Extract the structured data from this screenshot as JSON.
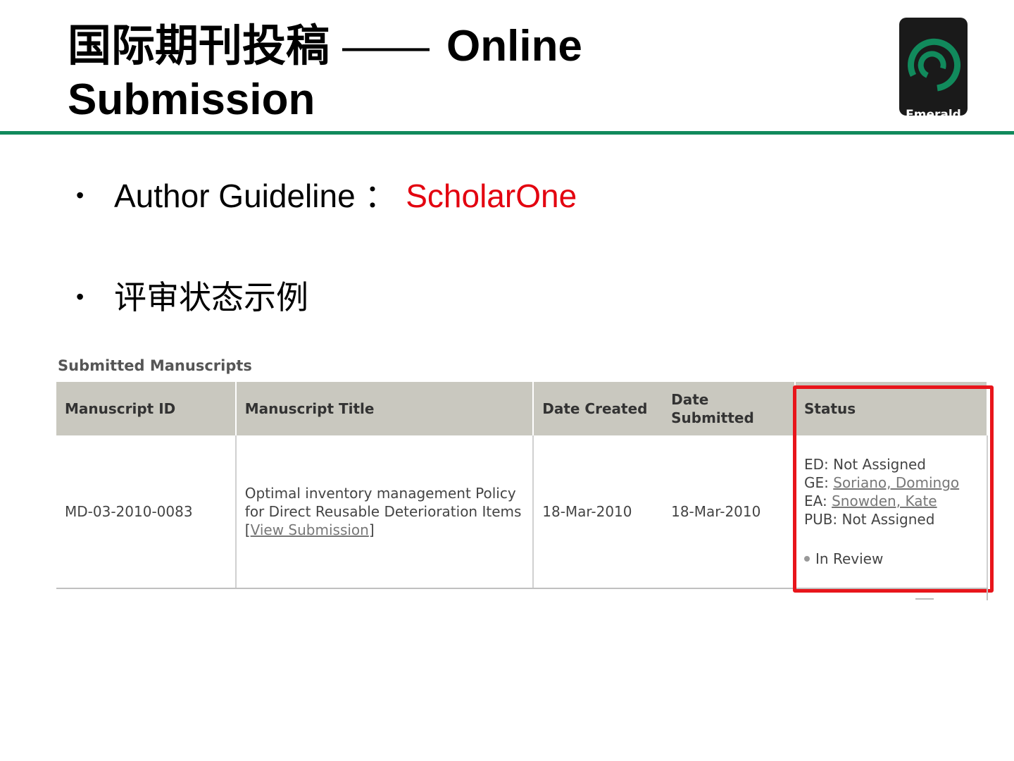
{
  "title": {
    "line1_cn": "国际期刊投稿",
    "dash": "——",
    "line1_en": "Online",
    "line2": "Submission"
  },
  "logo": {
    "text": "Emerald",
    "icon": "emerald-logo-icon",
    "colors": {
      "background": "#1a1a1a",
      "accent": "#118a5c"
    }
  },
  "bullets": [
    {
      "label": "Author Guideline ：",
      "highlight": "ScholarOne",
      "highlight_color": "#e3000f"
    },
    {
      "label": "评审状态示例"
    }
  ],
  "screenshot": {
    "heading": "Submitted Manuscripts",
    "columns": [
      "Manuscript ID",
      "Manuscript Title",
      "Date Created",
      "Date Submitted",
      "Status"
    ],
    "row": {
      "id": "MD-03-2010-0083",
      "title": "Optimal inventory management Policy for Direct Reusable Deterioration Items [",
      "view_link": "View Submission",
      "title_end": "]",
      "date_created": "18-Mar-2010",
      "date_submitted": "18-Mar-2010",
      "status": {
        "ed_label": "ED:",
        "ed_value": "Not Assigned",
        "ge_label": "GE:",
        "ge_value": "Soriano, Domingo",
        "ea_label": "EA:",
        "ea_value": "Snowden, Kate",
        "pub_label": "PUB:",
        "pub_value": "Not Assigned",
        "state": "In Review"
      }
    },
    "header_color": "#c9c8bf",
    "highlight_color": "#e8151b"
  }
}
